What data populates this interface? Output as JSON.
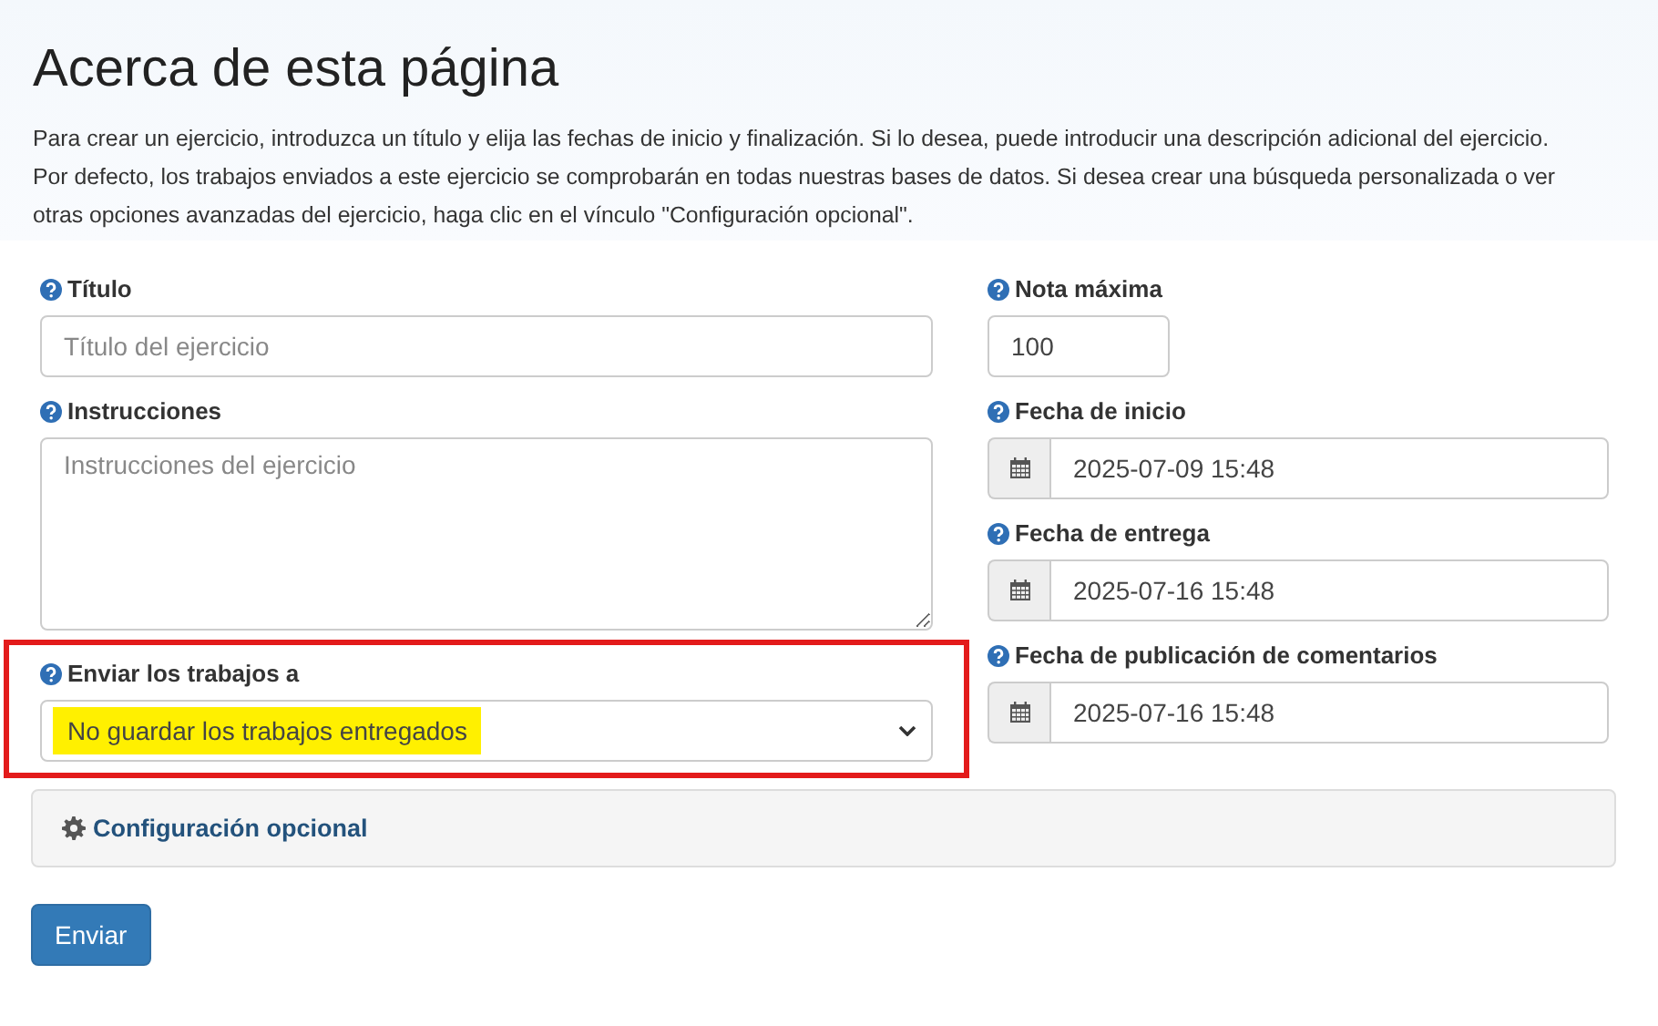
{
  "heading": "Acerca de esta página",
  "intro": "Para crear un ejercicio, introduzca un título y elija las fechas de inicio y finalización. Si lo desea, puede introducir una descripción adicional del ejercicio. Por defecto, los trabajos enviados a este ejercicio se comprobarán en todas nuestras bases de datos. Si desea crear una búsqueda personalizada o ver otras opciones avanzadas del ejercicio, haga clic en el vínculo \"Configuración opcional\".",
  "left_fields": [
    {
      "kind": "text",
      "label": "Título",
      "placeholder": "Título del ejercicio"
    },
    {
      "kind": "textarea",
      "label": "Instrucciones",
      "placeholder": "Instrucciones del ejercicio"
    },
    {
      "kind": "select",
      "label": "Enviar los trabajos a",
      "value": "No guardar los trabajos entregados",
      "highlighted": true,
      "framed": true
    }
  ],
  "right_fields": [
    {
      "kind": "short",
      "label": "Nota máxima",
      "value": "100"
    },
    {
      "kind": "date",
      "label": "Fecha de inicio",
      "value": "2025-07-09 15:48"
    },
    {
      "kind": "date",
      "label": "Fecha de entrega",
      "value": "2025-07-16 15:48"
    },
    {
      "kind": "date",
      "label": "Fecha de publicación de comentarios",
      "value": "2025-07-16 15:48"
    }
  ],
  "optional_panel": {
    "title": "Configuración opcional"
  },
  "submit_button": "Enviar"
}
